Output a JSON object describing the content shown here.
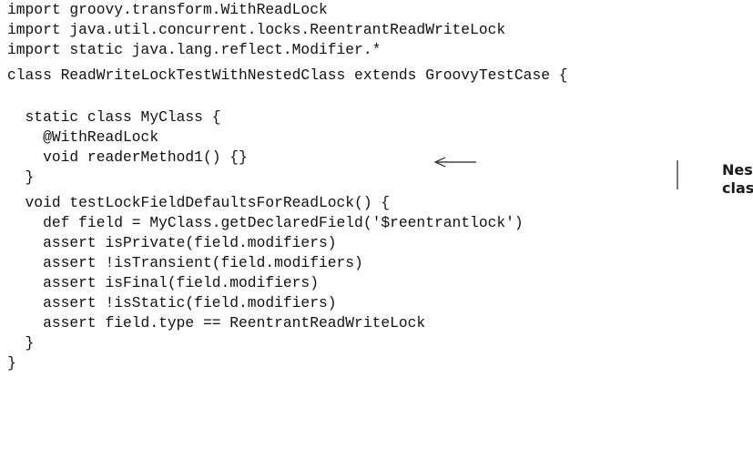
{
  "code_lines": [
    "import groovy.transform.WithReadLock",
    "import java.util.concurrent.locks.ReentrantReadWriteLock",
    "import static java.lang.reflect.Modifier.*",
    "class ReadWriteLockTestWithNestedClass extends GroovyTestCase {",
    "  static class MyClass {",
    "    @WithReadLock",
    "    void readerMethod1() {}",
    "  }",
    "  void testLockFieldDefaultsForReadLock() {",
    "    def field = MyClass.getDeclaredField('$reentrantlock')",
    "    assert isPrivate(field.modifiers)",
    "    assert !isTransient(field.modifiers)",
    "    assert isFinal(field.modifiers)",
    "    assert !isStatic(field.modifiers)",
    "    assert field.type == ReentrantReadWriteLock",
    "  }",
    "}"
  ],
  "annotation": {
    "line1": "Nested",
    "line2": "class"
  }
}
